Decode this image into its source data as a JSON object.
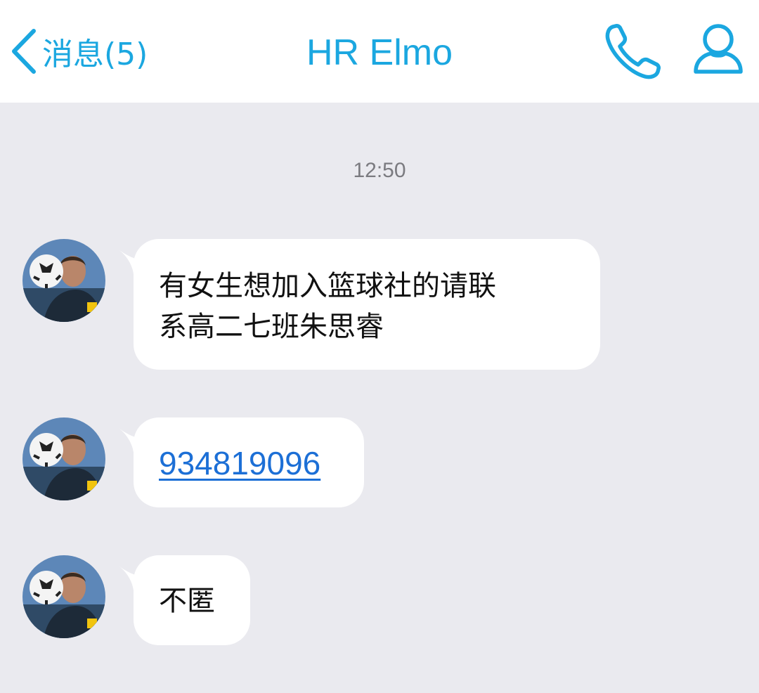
{
  "header": {
    "back_label": "消息(5)",
    "title": "HR Elmo",
    "accent_color": "#1ba7e0",
    "call_icon": "phone-icon",
    "profile_icon": "user-icon"
  },
  "chat": {
    "timestamp": "12:50",
    "messages": [
      {
        "text": "有女生想加入篮球社的请联\n系高二七班朱思睿",
        "type": "text"
      },
      {
        "text": "934819096",
        "type": "link"
      },
      {
        "text": "不匿",
        "type": "text"
      }
    ],
    "avatar_icon": "contact-avatar"
  }
}
